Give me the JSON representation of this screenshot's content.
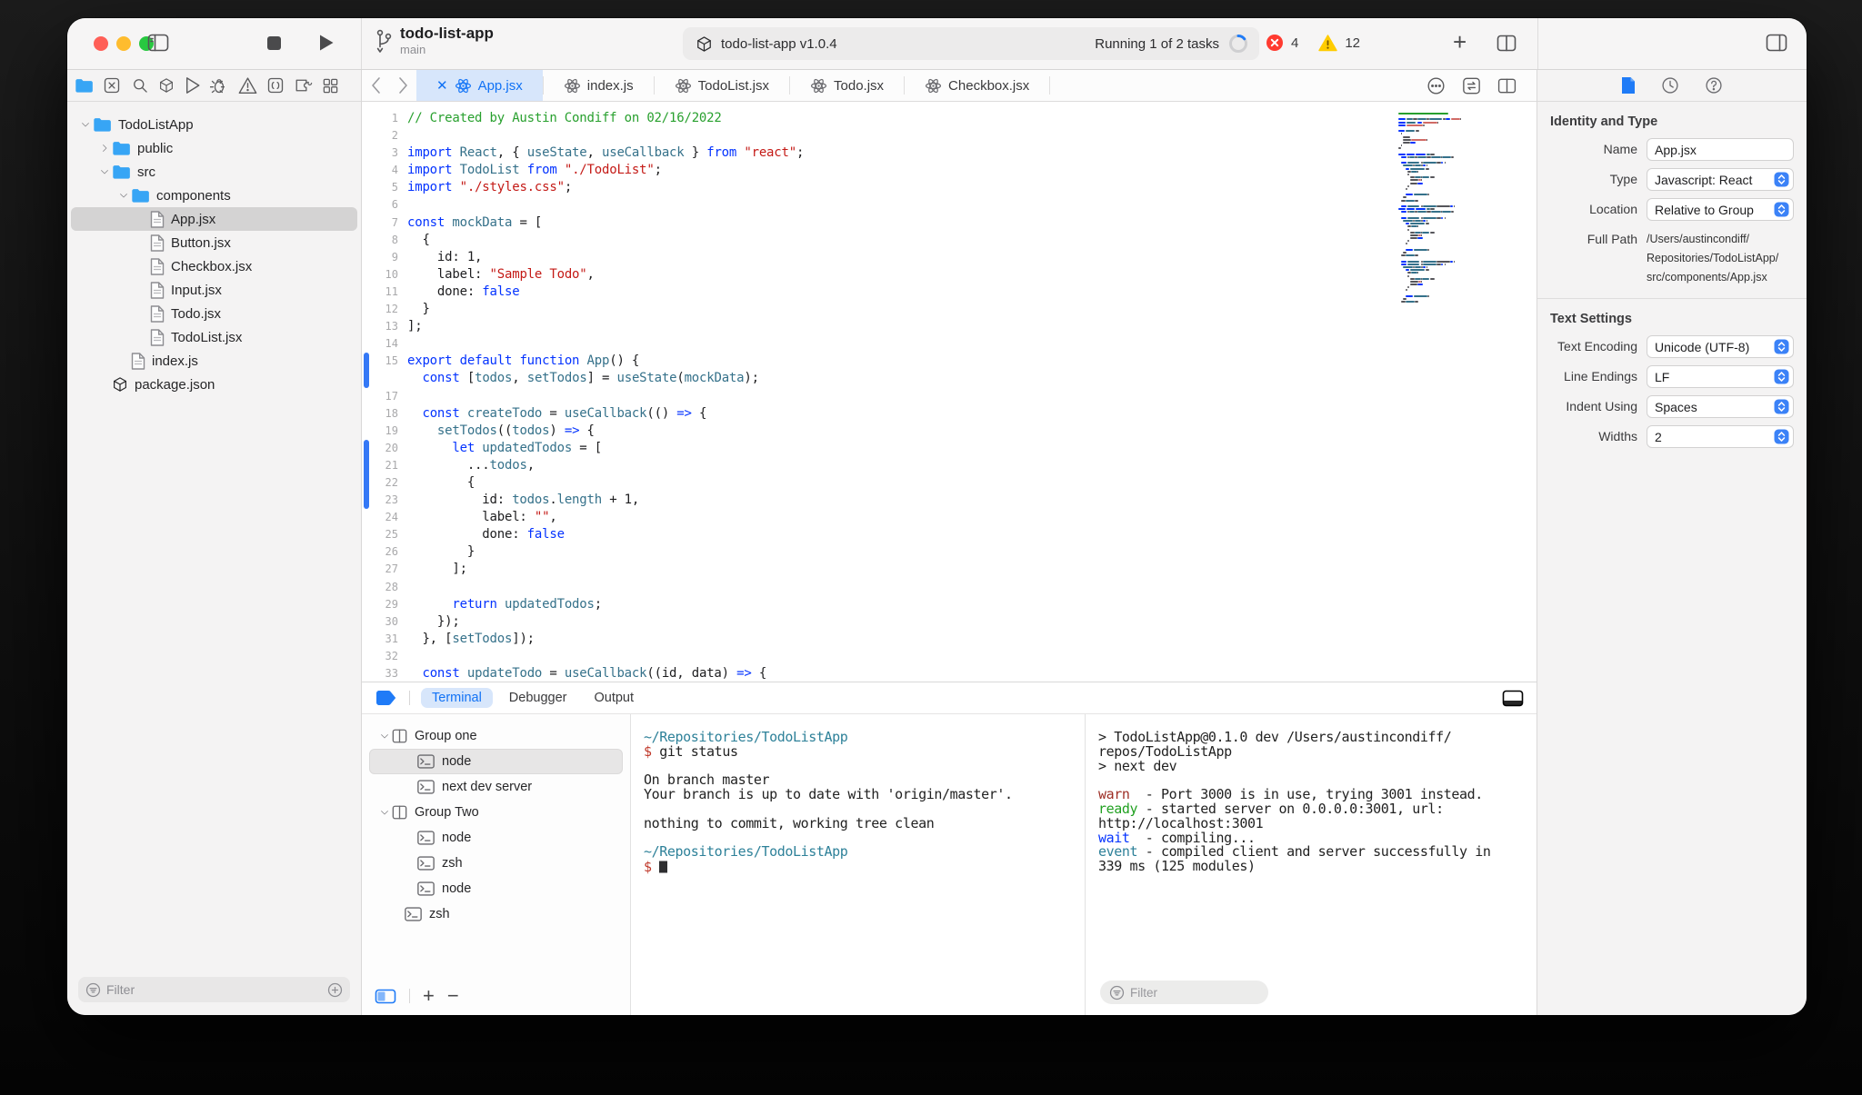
{
  "colors": {
    "accent": "#1172f5",
    "kw": "#0433ff",
    "ident": "#35718a",
    "str": "#c41a16",
    "com": "#28a02e",
    "chbar": "#3478f6",
    "tpath": "#2e8199",
    "tdollar": "#c0392b",
    "twarn": "#9d2d24",
    "tready": "#21a121",
    "twait": "#0433ff",
    "tevent": "#2e8199",
    "error": "#ff3b30",
    "warning": "#ffcc00",
    "folder": "#37a5f5",
    "traffic_red": "#ff5f57",
    "traffic_yellow": "#febc2e",
    "traffic_green": "#28c840"
  },
  "window": {
    "title": "todo-list-app",
    "branch": "main"
  },
  "toolbar": {
    "status_left": "todo-list-app v1.0.4",
    "status_right": "Running 1 of 2 tasks",
    "error_count": "4",
    "warning_count": "12",
    "plus_label": "+"
  },
  "navigator": {
    "icons": [
      "folder",
      "symbols",
      "search",
      "package",
      "run",
      "debug",
      "warnings",
      "snippets",
      "extensions",
      "grid"
    ],
    "active_icon": 0,
    "tree": [
      {
        "label": "TodoListApp",
        "depth": 0,
        "icon": "folder",
        "chevron": "down"
      },
      {
        "label": "public",
        "depth": 1,
        "icon": "folder",
        "chevron": "right"
      },
      {
        "label": "src",
        "depth": 1,
        "icon": "folder",
        "chevron": "down"
      },
      {
        "label": "components",
        "depth": 2,
        "icon": "folder",
        "chevron": "down"
      },
      {
        "label": "App.jsx",
        "depth": 3,
        "icon": "file",
        "selected": true
      },
      {
        "label": "Button.jsx",
        "depth": 3,
        "icon": "file"
      },
      {
        "label": "Checkbox.jsx",
        "depth": 3,
        "icon": "file"
      },
      {
        "label": "Input.jsx",
        "depth": 3,
        "icon": "file"
      },
      {
        "label": "Todo.jsx",
        "depth": 3,
        "icon": "file"
      },
      {
        "label": "TodoList.jsx",
        "depth": 3,
        "icon": "file"
      },
      {
        "label": "index.js",
        "depth": 2,
        "icon": "file"
      },
      {
        "label": "package.json",
        "depth": 1,
        "icon": "package"
      }
    ],
    "filter_placeholder": "Filter"
  },
  "tabs": [
    {
      "label": "App.jsx",
      "active": true
    },
    {
      "label": "index.js",
      "active": false
    },
    {
      "label": "TodoList.jsx",
      "active": false
    },
    {
      "label": "Todo.jsx",
      "active": false
    },
    {
      "label": "Checkbox.jsx",
      "active": false
    }
  ],
  "editor": {
    "change_bars": [
      [
        15,
        16
      ],
      [
        20,
        23
      ]
    ],
    "lines": [
      {
        "n": "1",
        "t": [
          [
            "// Created by Austin Condiff on 02/16/2022",
            "c"
          ]
        ]
      },
      {
        "n": "2",
        "t": []
      },
      {
        "n": "3",
        "t": [
          [
            "import",
            "k"
          ],
          [
            " ",
            "p"
          ],
          [
            "React",
            "i"
          ],
          [
            ", { ",
            "p"
          ],
          [
            "useState",
            "i"
          ],
          [
            ", ",
            "p"
          ],
          [
            "useCallback",
            "i"
          ],
          [
            " } ",
            "p"
          ],
          [
            "from",
            "k"
          ],
          [
            " ",
            "p"
          ],
          [
            "\"react\"",
            "s"
          ],
          [
            ";",
            "p"
          ]
        ]
      },
      {
        "n": "4",
        "t": [
          [
            "import",
            "k"
          ],
          [
            " ",
            "p"
          ],
          [
            "TodoList",
            "i"
          ],
          [
            " ",
            "p"
          ],
          [
            "from",
            "k"
          ],
          [
            " ",
            "p"
          ],
          [
            "\"./TodoList\"",
            "s"
          ],
          [
            ";",
            "p"
          ]
        ]
      },
      {
        "n": "5",
        "t": [
          [
            "import",
            "k"
          ],
          [
            " ",
            "p"
          ],
          [
            "\"./styles.css\"",
            "s"
          ],
          [
            ";",
            "p"
          ]
        ]
      },
      {
        "n": "6",
        "t": []
      },
      {
        "n": "7",
        "t": [
          [
            "const",
            "k"
          ],
          [
            " ",
            "p"
          ],
          [
            "mockData",
            "i"
          ],
          [
            " = [",
            "p"
          ]
        ]
      },
      {
        "n": "8",
        "t": [
          [
            "  {",
            "p"
          ]
        ]
      },
      {
        "n": "9",
        "t": [
          [
            "    id: 1,",
            "p"
          ]
        ]
      },
      {
        "n": "10",
        "t": [
          [
            "    label: ",
            "p"
          ],
          [
            "\"Sample Todo\"",
            "s"
          ],
          [
            ",",
            "p"
          ]
        ]
      },
      {
        "n": "11",
        "t": [
          [
            "    done: ",
            "p"
          ],
          [
            "false",
            "k"
          ]
        ]
      },
      {
        "n": "12",
        "t": [
          [
            "  }",
            "p"
          ]
        ]
      },
      {
        "n": "13",
        "t": [
          [
            "];",
            "p"
          ]
        ]
      },
      {
        "n": "14",
        "t": []
      },
      {
        "n": "15",
        "t": [
          [
            "export",
            "k"
          ],
          [
            " ",
            "p"
          ],
          [
            "default",
            "k"
          ],
          [
            " ",
            "p"
          ],
          [
            "function",
            "k"
          ],
          [
            " ",
            "p"
          ],
          [
            "App",
            "i"
          ],
          [
            "() {",
            "p"
          ]
        ]
      },
      {
        "n": "",
        "t": [
          [
            "  ",
            "p"
          ],
          [
            "const",
            "k"
          ],
          [
            " [",
            "p"
          ],
          [
            "todos",
            "i"
          ],
          [
            ", ",
            "p"
          ],
          [
            "setTodos",
            "i"
          ],
          [
            "] = ",
            "p"
          ],
          [
            "useState",
            "i"
          ],
          [
            "(",
            "p"
          ],
          [
            "mockData",
            "i"
          ],
          [
            ");",
            "p"
          ]
        ]
      },
      {
        "n": "17",
        "t": []
      },
      {
        "n": "18",
        "t": [
          [
            "  ",
            "p"
          ],
          [
            "const",
            "k"
          ],
          [
            " ",
            "p"
          ],
          [
            "createTodo",
            "i"
          ],
          [
            " = ",
            "p"
          ],
          [
            "useCallback",
            "i"
          ],
          [
            "(() ",
            "p"
          ],
          [
            "=>",
            "k"
          ],
          [
            " {",
            "p"
          ]
        ]
      },
      {
        "n": "19",
        "t": [
          [
            "    ",
            "p"
          ],
          [
            "setTodos",
            "i"
          ],
          [
            "((",
            "p"
          ],
          [
            "todos",
            "i"
          ],
          [
            ") ",
            "p"
          ],
          [
            "=>",
            "k"
          ],
          [
            " {",
            "p"
          ]
        ]
      },
      {
        "n": "20",
        "t": [
          [
            "      ",
            "p"
          ],
          [
            "let",
            "k"
          ],
          [
            " ",
            "p"
          ],
          [
            "updatedTodos",
            "i"
          ],
          [
            " = [",
            "p"
          ]
        ]
      },
      {
        "n": "21",
        "t": [
          [
            "        ...",
            "p"
          ],
          [
            "todos",
            "i"
          ],
          [
            ",",
            "p"
          ]
        ]
      },
      {
        "n": "22",
        "t": [
          [
            "        {",
            "p"
          ]
        ]
      },
      {
        "n": "23",
        "t": [
          [
            "          id: ",
            "p"
          ],
          [
            "todos",
            "i"
          ],
          [
            ".",
            "p"
          ],
          [
            "length",
            "i"
          ],
          [
            " + 1,",
            "p"
          ]
        ]
      },
      {
        "n": "24",
        "t": [
          [
            "          label: ",
            "p"
          ],
          [
            "\"\"",
            "s"
          ],
          [
            ",",
            "p"
          ]
        ]
      },
      {
        "n": "25",
        "t": [
          [
            "          done: ",
            "p"
          ],
          [
            "false",
            "k"
          ]
        ]
      },
      {
        "n": "26",
        "t": [
          [
            "        }",
            "p"
          ]
        ]
      },
      {
        "n": "27",
        "t": [
          [
            "      ];",
            "p"
          ]
        ]
      },
      {
        "n": "28",
        "t": []
      },
      {
        "n": "29",
        "t": [
          [
            "      ",
            "p"
          ],
          [
            "return",
            "k"
          ],
          [
            " ",
            "p"
          ],
          [
            "updatedTodos",
            "i"
          ],
          [
            ";",
            "p"
          ]
        ]
      },
      {
        "n": "30",
        "t": [
          [
            "    });",
            "p"
          ]
        ]
      },
      {
        "n": "31",
        "t": [
          [
            "  }, [",
            "p"
          ],
          [
            "setTodos",
            "i"
          ],
          [
            "]);",
            "p"
          ]
        ]
      },
      {
        "n": "32",
        "t": []
      },
      {
        "n": "33",
        "t": [
          [
            "  ",
            "p"
          ],
          [
            "const",
            "k"
          ],
          [
            " ",
            "p"
          ],
          [
            "updateTodo",
            "i"
          ],
          [
            " = ",
            "p"
          ],
          [
            "useCallback",
            "i"
          ],
          [
            "((id, data) ",
            "p"
          ],
          [
            "=>",
            "k"
          ],
          [
            " {",
            "p"
          ]
        ]
      }
    ]
  },
  "bottom": {
    "tabs": [
      {
        "label": "Terminal",
        "active": true
      },
      {
        "label": "Debugger",
        "active": false
      },
      {
        "label": "Output",
        "active": false
      }
    ],
    "terminal_list": [
      {
        "label": "Group one",
        "type": "group",
        "depth": 0,
        "chevron": "down"
      },
      {
        "label": "node",
        "type": "term",
        "depth": 1,
        "selected": true
      },
      {
        "label": "next dev server",
        "type": "term",
        "depth": 1
      },
      {
        "label": "Group Two",
        "type": "group",
        "depth": 0,
        "chevron": "down"
      },
      {
        "label": "node",
        "type": "term",
        "depth": 1
      },
      {
        "label": "zsh",
        "type": "term",
        "depth": 1
      },
      {
        "label": "node",
        "type": "term",
        "depth": 1
      },
      {
        "label": "zsh",
        "type": "term",
        "depth": 0.5
      }
    ],
    "term1": [
      [
        [
          "~/Repositories/TodoListApp",
          "path"
        ]
      ],
      [
        [
          "$",
          "d"
        ],
        [
          " git status",
          "p"
        ]
      ],
      [],
      [
        [
          "On branch master",
          "p"
        ]
      ],
      [
        [
          "Your branch is up to date with 'origin/master'.",
          "p"
        ]
      ],
      [],
      [
        [
          "nothing to commit, working tree clean",
          "p"
        ]
      ],
      [],
      [
        [
          "~/Repositories/TodoListApp",
          "path"
        ]
      ],
      [
        [
          "$ ",
          "d"
        ],
        [
          "█",
          "cursor"
        ]
      ]
    ],
    "term2": [
      [
        [
          "> TodoListApp@0.1.0 dev /Users/austincondiff/",
          "p"
        ]
      ],
      [
        [
          "repos/TodoListApp",
          "p"
        ]
      ],
      [
        [
          "> next dev",
          "p"
        ]
      ],
      [],
      [
        [
          "warn",
          "w"
        ],
        [
          "  - Port 3000 is in use, trying 3001 instead.",
          "p"
        ]
      ],
      [
        [
          "ready",
          "g"
        ],
        [
          " - started server on 0.0.0.0:3001, url:",
          "p"
        ]
      ],
      [
        [
          "http://localhost:3001",
          "p"
        ]
      ],
      [
        [
          "wait",
          "b"
        ],
        [
          "  - compiling...",
          "p"
        ]
      ],
      [
        [
          "event",
          "e"
        ],
        [
          " - compiled client and server successfully in",
          "p"
        ]
      ],
      [
        [
          "339 ms (125 modules)",
          "p"
        ]
      ]
    ],
    "filter_placeholder": "Filter"
  },
  "inspector": {
    "sections": [
      {
        "title": "Identity and Type",
        "rows": [
          {
            "label": "Name",
            "type": "input",
            "value": "App.jsx"
          },
          {
            "label": "Type",
            "type": "select",
            "value": "Javascript: React"
          },
          {
            "label": "Location",
            "type": "select",
            "value": "Relative to Group"
          },
          {
            "label": "Full Path",
            "type": "text",
            "lines": [
              "/Users/austincondiff/",
              "Repositories/TodoListApp/",
              "src/components/App.jsx"
            ]
          }
        ]
      },
      {
        "title": "Text Settings",
        "rows": [
          {
            "label": "Text Encoding",
            "type": "select",
            "value": "Unicode (UTF-8)"
          },
          {
            "label": "Line Endings",
            "type": "select",
            "value": "LF"
          },
          {
            "label": "Indent Using",
            "type": "select",
            "value": "Spaces"
          },
          {
            "label": "Widths",
            "type": "select",
            "value": "2"
          }
        ]
      }
    ]
  }
}
